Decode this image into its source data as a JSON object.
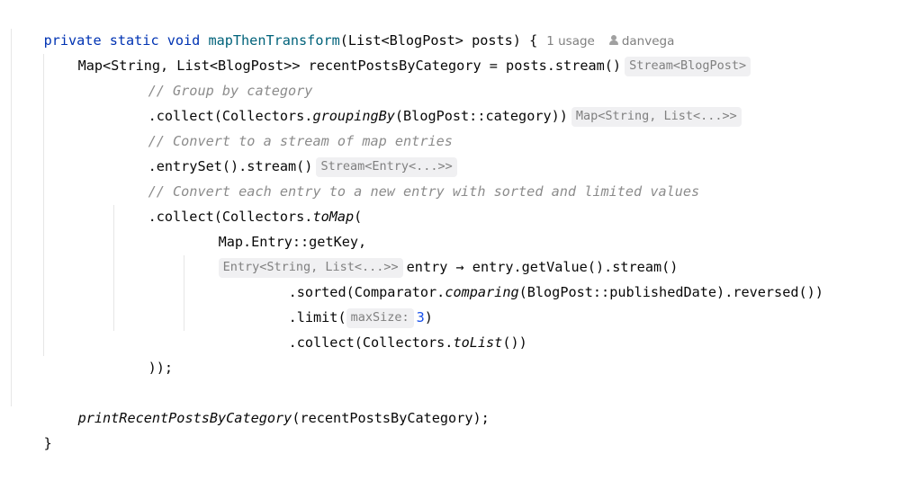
{
  "code": {
    "l1": {
      "kw": "private static void ",
      "method": "mapThenTransform",
      "rest": "(List<BlogPost> posts) {",
      "usage": "1 usage",
      "author": "danvega"
    },
    "l2": {
      "code": "Map<String, List<BlogPost>> recentPostsByCategory = posts.stream()",
      "hint": "Stream<BlogPost>"
    },
    "l3": {
      "comment": "// Group by category"
    },
    "l4": {
      "pre": ".collect(Collectors.",
      "call": "groupingBy",
      "post": "(BlogPost::category))",
      "hint": "Map<String, List<...>>"
    },
    "l5": {
      "comment": "// Convert to a stream of map entries"
    },
    "l6": {
      "code": ".entrySet().stream()",
      "hint": "Stream<Entry<...>>"
    },
    "l7": {
      "comment": "// Convert each entry to a new entry with sorted and limited values"
    },
    "l8": {
      "pre": ".collect(Collectors.",
      "call": "toMap",
      "post": "("
    },
    "l9": {
      "code": "Map.Entry::getKey,"
    },
    "l10": {
      "hint": "Entry<String, List<...>>",
      "code": "entry → entry.getValue().stream()"
    },
    "l11": {
      "pre": ".sorted(Comparator.",
      "call": "comparing",
      "post": "(BlogPost::publishedDate).reversed())"
    },
    "l12": {
      "pre": ".limit(",
      "hint": "maxSize:",
      "num": "3",
      "post": ")"
    },
    "l13": {
      "pre": ".collect(Collectors.",
      "call": "toList",
      "post": "())"
    },
    "l14": {
      "code": "));"
    },
    "l16": {
      "call": "printRecentPostsByCategory",
      "post": "(recentPostsByCategory);"
    },
    "l17": {
      "code": "}"
    }
  }
}
